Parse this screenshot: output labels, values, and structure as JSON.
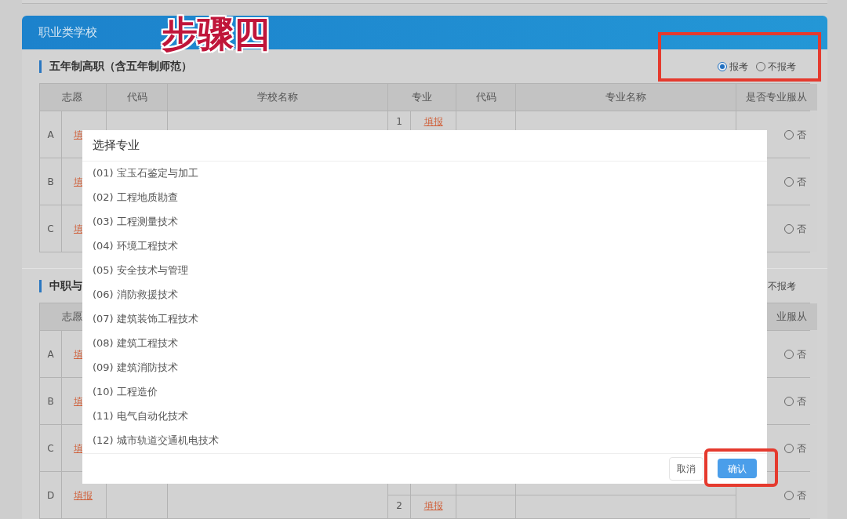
{
  "card": {
    "title": "职业类学校"
  },
  "annotation": {
    "text": "步骤四"
  },
  "sections": [
    {
      "title": "五年制高职（含五年制师范）",
      "options": [
        {
          "label": "报考",
          "selected": true
        },
        {
          "label": "不报考",
          "selected": false
        }
      ],
      "header": {
        "choice": "志愿",
        "school_code": "代码",
        "school_name": "学校名称",
        "major": "专业",
        "major_code": "代码",
        "major_name": "专业名称",
        "comply": "是否专业服从"
      },
      "rows": [
        {
          "choice": "A",
          "fill": "填",
          "major_1": {
            "num": "1",
            "fill": "填报"
          },
          "comply": {
            "label": "否",
            "selected": false
          }
        },
        {
          "choice": "B",
          "fill": "填",
          "comply": {
            "label": "否",
            "selected": false
          }
        },
        {
          "choice": "C",
          "fill": "填",
          "comply": {
            "label": "否",
            "selected": false
          }
        }
      ]
    },
    {
      "title": "中职与",
      "options": [
        {
          "label": "不报考"
        }
      ],
      "header": {
        "choice": "志愿",
        "comply": "业服从"
      },
      "rows": [
        {
          "choice": "A",
          "fill": "填",
          "comply": {
            "label": "否",
            "selected": false
          }
        },
        {
          "choice": "B",
          "fill": "填",
          "comply": {
            "label": "否",
            "selected": false
          }
        },
        {
          "choice": "C",
          "fill": "填",
          "comply": {
            "label": "否",
            "selected": false
          }
        },
        {
          "choice": "D",
          "fill": "填报",
          "major_2": {
            "num": "2",
            "fill": "填报"
          },
          "comply": {
            "label": "否",
            "selected": false
          }
        }
      ]
    }
  ],
  "dialog": {
    "title": "选择专业",
    "items": [
      "(01) 宝玉石鉴定与加工",
      "(02) 工程地质勘查",
      "(03) 工程测量技术",
      "(04) 环境工程技术",
      "(05) 安全技术与管理",
      "(06) 消防救援技术",
      "(07) 建筑装饰工程技术",
      "(08) 建筑工程技术",
      "(09) 建筑消防技术",
      "(10) 工程造价",
      "(11) 电气自动化技术",
      "(12) 城市轨道交通机电技术"
    ],
    "buttons": [
      {
        "label": "取消",
        "kind": "secondary"
      },
      {
        "label": "确认",
        "kind": "primary"
      }
    ]
  }
}
